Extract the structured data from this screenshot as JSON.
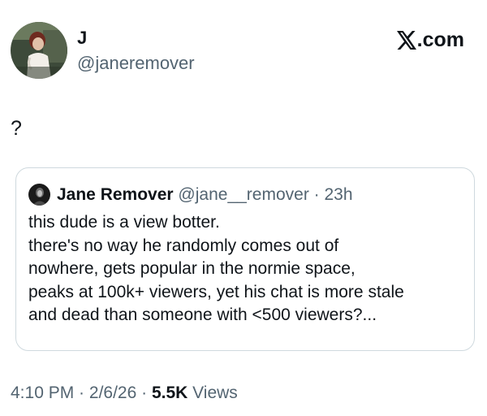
{
  "author": {
    "display_name": "J",
    "handle": "@janeremover",
    "avatar_icon": "profile-photo-avatar"
  },
  "brand": {
    "label": ".com",
    "icon": "x-logo-icon"
  },
  "tweet": {
    "text": "?"
  },
  "quoted_tweet": {
    "display_name": "Jane Remover",
    "handle": "@jane__remover",
    "separator": " · ",
    "time": "23h",
    "avatar_icon": "profile-photo-avatar",
    "lines": [
      "this dude is a view botter.",
      "there's no way he randomly comes out of",
      "nowhere, gets popular in the normie space,",
      "peaks at 100k+ viewers, yet his chat is more stale",
      "and dead than someone with <500 viewers?..."
    ]
  },
  "footer": {
    "time": "4:10 PM",
    "separator": " · ",
    "date": "2/6/26",
    "views_count": "5.5K",
    "views_label": " Views"
  },
  "colors": {
    "text": "#0f1419",
    "secondary": "#536471",
    "border": "#cfd9de"
  }
}
